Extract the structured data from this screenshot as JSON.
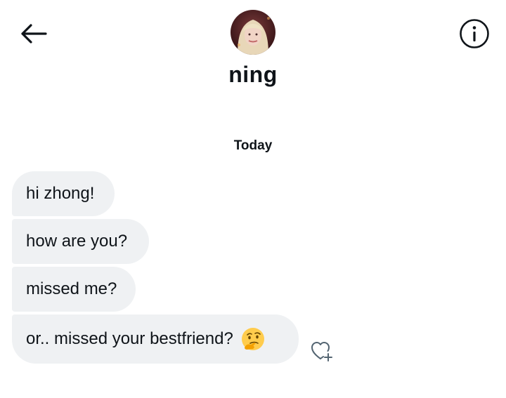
{
  "header": {
    "contact_name": "ning",
    "back_icon": "back-arrow-icon",
    "info_icon": "info-icon"
  },
  "conversation": {
    "day_label": "Today",
    "messages": [
      {
        "text": "hi zhong!"
      },
      {
        "text": "how are you?"
      },
      {
        "text": "missed me?"
      },
      {
        "text": "or.. missed your bestfriend?",
        "emoji": "thinking-face-icon"
      }
    ],
    "reaction_icon": "heart-plus-icon"
  },
  "colors": {
    "bubble_bg": "#eff1f3",
    "text": "#0f1419"
  }
}
